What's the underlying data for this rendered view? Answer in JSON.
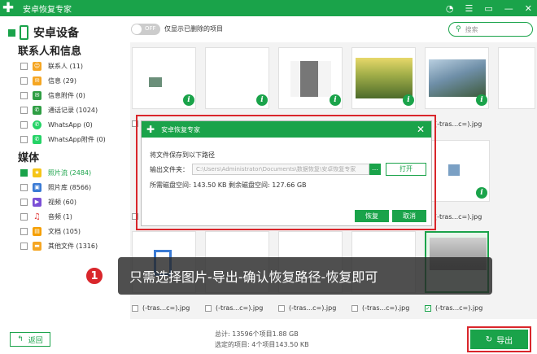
{
  "app": {
    "title": "安卓恢复专家"
  },
  "sidebar": {
    "device": "安卓设备",
    "section_contacts": "联系人和信息",
    "section_media": "媒体",
    "contacts_items": [
      {
        "label": "联系人 (11)",
        "icon": "contacts-icon",
        "color": "#f5a623"
      },
      {
        "label": "信息 (29)",
        "icon": "message-icon",
        "color": "#f5a623"
      },
      {
        "label": "信息附件 (0)",
        "icon": "attachment-icon",
        "color": "#2f9e44"
      },
      {
        "label": "通话记录 (1024)",
        "icon": "phone-icon",
        "color": "#2f9e44"
      },
      {
        "label": "WhatsApp (0)",
        "icon": "whatsapp-icon",
        "color": "#25d366"
      },
      {
        "label": "WhatsApp附件 (0)",
        "icon": "whatsapp-attachment-icon",
        "color": "#25d366"
      }
    ],
    "media_items": [
      {
        "label": "照片流 (2484)",
        "icon": "photo-stream-icon",
        "color": "#f5c518",
        "checked": true
      },
      {
        "label": "照片库 (8566)",
        "icon": "photo-library-icon",
        "color": "#3a7bd5"
      },
      {
        "label": "视频 (60)",
        "icon": "video-icon",
        "color": "#7b4fd6"
      },
      {
        "label": "音频 (1)",
        "icon": "audio-icon",
        "color": "#e03131"
      },
      {
        "label": "文档 (105)",
        "icon": "document-icon",
        "color": "#f59f00"
      },
      {
        "label": "其他文件 (1316)",
        "icon": "other-files-icon",
        "color": "#f5a623"
      }
    ],
    "back_label": "返回"
  },
  "toolbar": {
    "toggle_text": "OFF",
    "toggle_label": "仅显示已删除的项目",
    "search_placeholder": "搜索"
  },
  "grid": {
    "captions": [
      "(-tras...c=).jpg",
      "(-tras...c=).jpg",
      "(-tras...c=).jpg",
      "(-tras...c=).jpg",
      "(-tras...c=).jpg"
    ],
    "left_caption_prefix": "(",
    "right_caption": "(-tras...c=).jpg"
  },
  "dialog": {
    "title": "安卓恢复专家",
    "prompt": "将文件保存到以下路径",
    "output_label": "输出文件夹：",
    "output_path": "C:\\Users\\Administrator\\Documents\\数据恢复\\安卓恢复专家",
    "open_button": "打开",
    "required_space": "所需磁盘空间:   143.50 KB  剩余磁盘空间:   127.66 GB",
    "recover_button": "恢复",
    "cancel_button": "取消"
  },
  "banner": {
    "step": "1",
    "text": "只需选择图片-导出-确认恢复路径-恢复即可"
  },
  "footer": {
    "total": "总计: 13596个项目1.88 GB",
    "selected": "选定的项目: 4个项目143.50 KB",
    "export_button": "导出"
  }
}
